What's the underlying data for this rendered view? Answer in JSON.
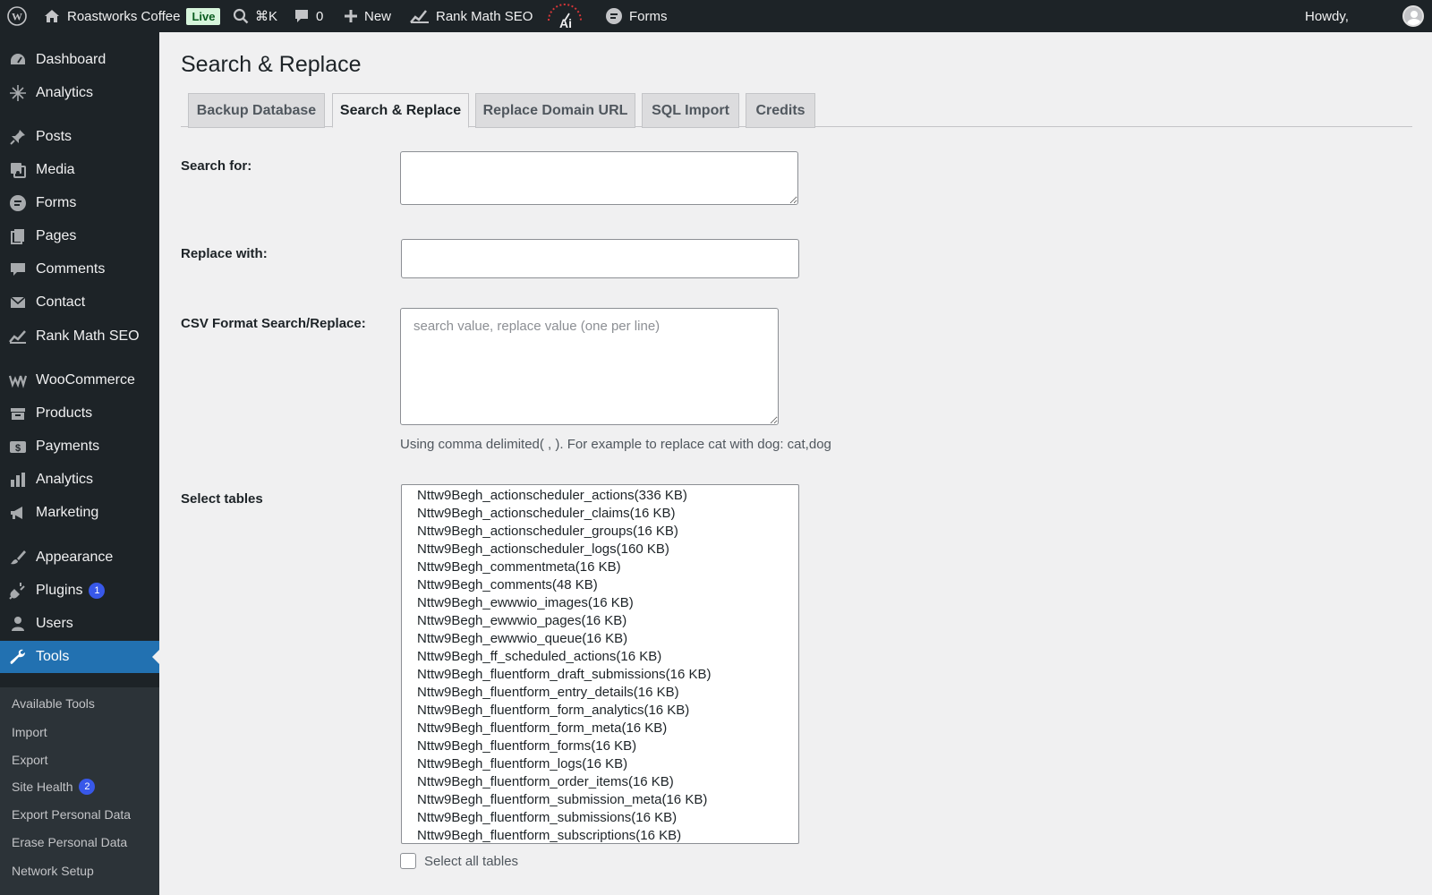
{
  "admin_bar": {
    "site_name": "Roastworks Coffee",
    "live_badge": "Live",
    "command_shortcut": "⌘K",
    "comments_count": "0",
    "new_label": "New",
    "rank_math_label": "Rank Math SEO",
    "forms_label": "Forms",
    "howdy": "Howdy,"
  },
  "sidebar": {
    "items": [
      {
        "label": "Dashboard",
        "icon": "dashboard-icon"
      },
      {
        "label": "Analytics",
        "icon": "analytics-sparkle-icon"
      },
      {
        "label": "Posts",
        "icon": "pushpin-icon"
      },
      {
        "label": "Media",
        "icon": "media-icon"
      },
      {
        "label": "Forms",
        "icon": "forms-icon"
      },
      {
        "label": "Pages",
        "icon": "pages-icon"
      },
      {
        "label": "Comments",
        "icon": "comment-icon"
      },
      {
        "label": "Contact",
        "icon": "envelope-icon"
      },
      {
        "label": "Rank Math SEO",
        "icon": "rank-math-icon"
      },
      {
        "label": "WooCommerce",
        "icon": "woocommerce-icon"
      },
      {
        "label": "Products",
        "icon": "products-icon"
      },
      {
        "label": "Payments",
        "icon": "payments-icon"
      },
      {
        "label": "Analytics",
        "icon": "bar-chart-icon"
      },
      {
        "label": "Marketing",
        "icon": "megaphone-icon"
      },
      {
        "label": "Appearance",
        "icon": "paintbrush-icon"
      },
      {
        "label": "Plugins",
        "icon": "plugin-icon",
        "badge": "1"
      },
      {
        "label": "Users",
        "icon": "user-icon"
      },
      {
        "label": "Tools",
        "icon": "wrench-icon",
        "active": true
      }
    ],
    "submenu": [
      {
        "label": "Available Tools"
      },
      {
        "label": "Import"
      },
      {
        "label": "Export"
      },
      {
        "label": "Site Health",
        "badge": "2"
      },
      {
        "label": "Export Personal Data"
      },
      {
        "label": "Erase Personal Data"
      },
      {
        "label": "Network Setup"
      }
    ]
  },
  "page": {
    "title": "Search & Replace",
    "tabs": [
      "Backup Database",
      "Search & Replace",
      "Replace Domain URL",
      "SQL Import",
      "Credits"
    ],
    "active_tab": "Search & Replace",
    "search_label": "Search for:",
    "search_value": "",
    "replace_label": "Replace with:",
    "replace_value": "",
    "csv_label": "CSV Format Search/Replace:",
    "csv_placeholder": "search value, replace value (one per line)",
    "csv_help": "Using comma delimited( , ). For example to replace cat with dog: cat,dog",
    "tables_label": "Select tables",
    "tables": [
      "Nttw9Begh_actionscheduler_actions(336 KB)",
      "Nttw9Begh_actionscheduler_claims(16 KB)",
      "Nttw9Begh_actionscheduler_groups(16 KB)",
      "Nttw9Begh_actionscheduler_logs(160 KB)",
      "Nttw9Begh_commentmeta(16 KB)",
      "Nttw9Begh_comments(48 KB)",
      "Nttw9Begh_ewwwio_images(16 KB)",
      "Nttw9Begh_ewwwio_pages(16 KB)",
      "Nttw9Begh_ewwwio_queue(16 KB)",
      "Nttw9Begh_ff_scheduled_actions(16 KB)",
      "Nttw9Begh_fluentform_draft_submissions(16 KB)",
      "Nttw9Begh_fluentform_entry_details(16 KB)",
      "Nttw9Begh_fluentform_form_analytics(16 KB)",
      "Nttw9Begh_fluentform_form_meta(16 KB)",
      "Nttw9Begh_fluentform_forms(16 KB)",
      "Nttw9Begh_fluentform_logs(16 KB)",
      "Nttw9Begh_fluentform_order_items(16 KB)",
      "Nttw9Begh_fluentform_submission_meta(16 KB)",
      "Nttw9Begh_fluentform_submissions(16 KB)",
      "Nttw9Begh_fluentform_subscriptions(16 KB)"
    ],
    "select_all_label": "Select all tables",
    "select_all_checked": false
  },
  "colors": {
    "admin_dark": "#1d2327",
    "submenu_bg": "#2c3338",
    "active_blue": "#2271b1",
    "badge_blue": "#3858e9",
    "live_green": "#d7f5dc"
  }
}
